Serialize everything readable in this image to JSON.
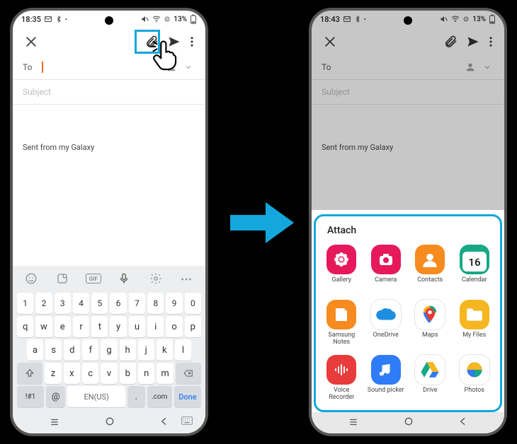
{
  "status_left": {
    "time1": "18:35",
    "time2": "18:43",
    "battery": "13%"
  },
  "compose": {
    "to_label": "To",
    "subject_placeholder": "Subject",
    "signature": "Sent from my Galaxy"
  },
  "keyboard": {
    "row_nums": [
      "1",
      "2",
      "3",
      "4",
      "5",
      "6",
      "7",
      "8",
      "9",
      "0"
    ],
    "row_q": [
      "q",
      "w",
      "e",
      "r",
      "t",
      "y",
      "u",
      "i",
      "o",
      "p"
    ],
    "row_a": [
      "a",
      "s",
      "d",
      "f",
      "g",
      "h",
      "j",
      "k",
      "l"
    ],
    "row_z": [
      "z",
      "x",
      "c",
      "v",
      "b",
      "n",
      "m"
    ],
    "sym_key": "!#1",
    "at_key": "@",
    "lang_key": "EN(US)",
    "period_key": ".",
    "com_key": ".com",
    "done_key": "Done"
  },
  "sheet": {
    "title": "Attach",
    "apps": [
      {
        "k": "gallery",
        "label": "Gallery",
        "bg": "#E6195C"
      },
      {
        "k": "camera",
        "label": "Camera",
        "bg": "#E6195C"
      },
      {
        "k": "contacts",
        "label": "Contacts",
        "bg": "#F68B1F"
      },
      {
        "k": "calendar",
        "label": "Calendar",
        "bg": "#17A884",
        "day": "16"
      },
      {
        "k": "notes",
        "label": "Samsung Notes",
        "bg": "#F68B1F"
      },
      {
        "k": "onedrive",
        "label": "OneDrive",
        "bg": "#FFFFFF"
      },
      {
        "k": "maps",
        "label": "Maps",
        "bg": "#FFFFFF"
      },
      {
        "k": "myfiles",
        "label": "My Files",
        "bg": "#F6B61F"
      },
      {
        "k": "voice",
        "label": "Voice Recorder",
        "bg": "#E83B3B"
      },
      {
        "k": "soundpicker",
        "label": "Sound picker",
        "bg": "#2E7CF6"
      },
      {
        "k": "drive",
        "label": "Drive",
        "bg": "#FFFFFF"
      },
      {
        "k": "photos",
        "label": "Photos",
        "bg": "#FFFFFF"
      }
    ]
  }
}
